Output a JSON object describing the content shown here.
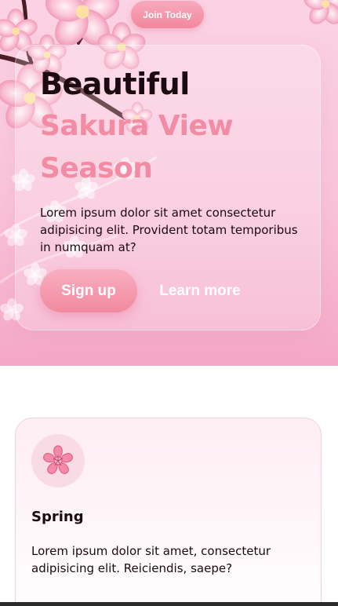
{
  "header": {
    "join_label": "Join Today"
  },
  "hero": {
    "title_line1": "Beautiful",
    "title_line2": "Sakura View",
    "title_line3": "Season",
    "description": "Lorem ipsum dolor sit amet consectetur adipisicing elit. Provident totam temporibus in numquam at?",
    "signup_label": "Sign up",
    "learn_more_label": "Learn more"
  },
  "features": [
    {
      "icon": "sakura-flower-icon",
      "title": "Spring",
      "description": "Lorem ipsum dolor sit amet, consectetur adipisicing elit. Reiciendis, saepe?"
    }
  ],
  "colors": {
    "accent_pink": "#f28ba4",
    "button_pink": "#f1899f",
    "hero_background": "#f9c4da",
    "text_dark": "#1b0a10"
  }
}
